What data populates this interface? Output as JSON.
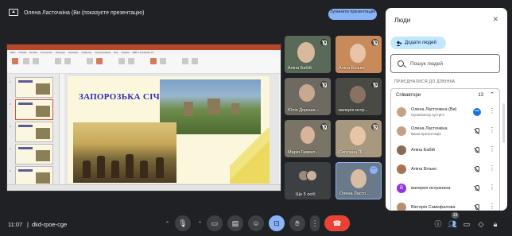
{
  "topbar": {
    "presenter_title": "Олена Ласточкіна (Ви (показуєте презентацію)",
    "stop_button": "Зупинити презентацію"
  },
  "slide": {
    "title": "ЗАПОРОЗЬКА СІЧ",
    "ribbon_tabs": [
      "Файл",
      "Главная",
      "Вставка",
      "Конструктор",
      "Переходы",
      "Анимация",
      "Слайд-шоу",
      "Рецензирование",
      "Вид",
      "Справка",
      "ABBYY FineReader 15"
    ]
  },
  "participants": [
    {
      "name": "Аліна Бабій",
      "muted": true
    },
    {
      "name": "Аліна Білько",
      "muted": true
    },
    {
      "name": "Юлія Дороше...",
      "muted": true
    },
    {
      "name": "валерія истр...",
      "muted": true
    },
    {
      "name": "Марія Гаврил...",
      "muted": true
    },
    {
      "name": "Світлана Пі...",
      "muted": true
    }
  ],
  "more_tile": {
    "label": "Ще 5 осіб"
  },
  "self_tile": {
    "label": "Олена Ласто..."
  },
  "bottom": {
    "time": "11:07",
    "separator": "|",
    "meeting_code": "dkd-rpoe-cge",
    "participant_badge": "13"
  },
  "panel": {
    "title": "Люди",
    "add_people": "Додати людей",
    "search_placeholder": "Пошук людей",
    "section_label": "ПРИЄДНАЛИСЯ ДО ДЗВІНКА",
    "group_label": "Співавтори",
    "group_count": "13",
    "people": [
      {
        "name": "Олена Ласточкіна (Ви)",
        "sub": "Організатор зустрічі"
      },
      {
        "name": "Олена Ласточкіна",
        "sub": "Ваша презентація"
      },
      {
        "name": "Аліна Бабій",
        "sub": ""
      },
      {
        "name": "Аліна Білько",
        "sub": ""
      },
      {
        "name": "валерия истранина",
        "sub": "",
        "initial": "В"
      },
      {
        "name": "Вікторія Самофалова",
        "sub": ""
      }
    ]
  },
  "colors": {
    "background": "#202124",
    "accent": "#8ab4f8",
    "end_call": "#ea4335",
    "slide_title": "#2b2bb5"
  }
}
